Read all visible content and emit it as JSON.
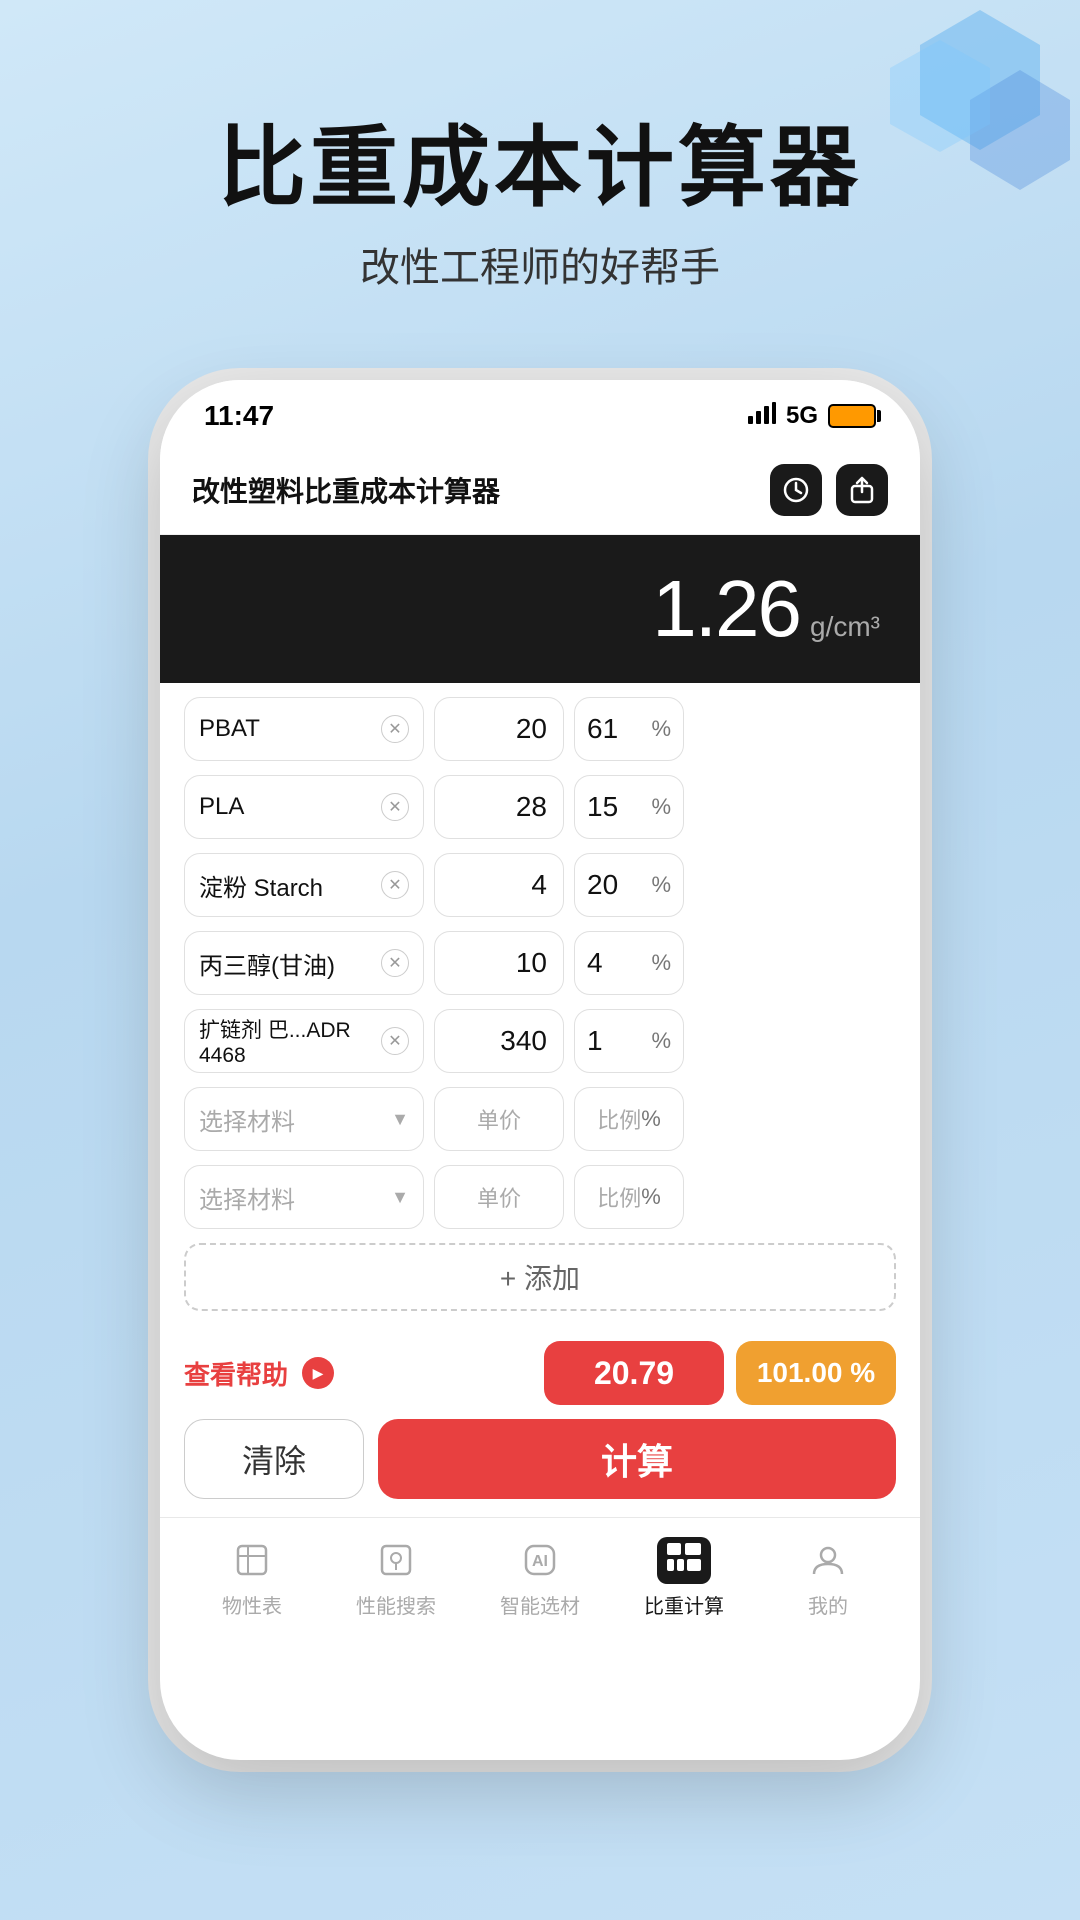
{
  "page": {
    "background_color": "#c5dff0"
  },
  "header": {
    "title_main": "比重成本计算器",
    "title_sub": "改性工程师的好帮手"
  },
  "status_bar": {
    "time": "11:47",
    "signal": "📶",
    "network": "5G"
  },
  "app": {
    "title": "改性塑料比重成本计算器",
    "result_value": "1.26",
    "result_unit": "g/cm³"
  },
  "ingredients": [
    {
      "name": "PBAT",
      "price": "20",
      "percent": "61"
    },
    {
      "name": "PLA",
      "price": "28",
      "percent": "15"
    },
    {
      "name": "淀粉 Starch",
      "price": "4",
      "percent": "20"
    },
    {
      "name": "丙三醇(甘油)",
      "price": "10",
      "percent": "4"
    },
    {
      "name": "扩链剂 巴...ADR 4468",
      "price": "340",
      "percent": "1"
    }
  ],
  "dropdowns": [
    {
      "placeholder": "选择材料",
      "price_placeholder": "单价",
      "pct_placeholder": "比例"
    },
    {
      "placeholder": "选择材料",
      "price_placeholder": "单价",
      "pct_placeholder": "比例"
    }
  ],
  "add_button": "+ 添加",
  "help": {
    "label": "查看帮助",
    "cost_value": "20.79",
    "ratio_value": "101.00 %"
  },
  "actions": {
    "clear": "清除",
    "calculate": "计算"
  },
  "bottom_nav": [
    {
      "label": "物性表",
      "icon": "table",
      "active": false
    },
    {
      "label": "性能搜索",
      "icon": "search-list",
      "active": false
    },
    {
      "label": "智能选材",
      "icon": "ai-chip",
      "active": false
    },
    {
      "label": "比重计算",
      "icon": "calc-grid",
      "active": true
    },
    {
      "label": "我的",
      "icon": "person",
      "active": false
    }
  ]
}
